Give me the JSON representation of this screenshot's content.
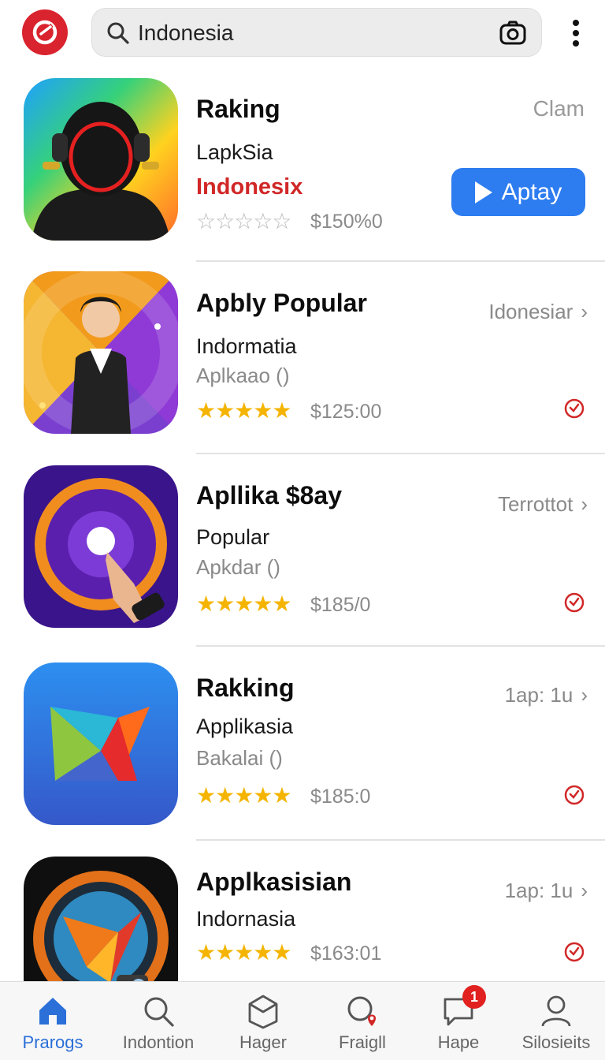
{
  "header": {
    "search_value": "Indonesia",
    "search_icon": "search-icon",
    "camera_icon": "camera-icon",
    "menu_icon": "more-vert-icon"
  },
  "colors": {
    "brand_red": "#d9232e",
    "accent_blue": "#2d7cf0",
    "star_gold": "#f4b400",
    "nav_active": "#2b6fd8"
  },
  "apps": [
    {
      "title": "Raking",
      "subtitle": "LapkSia",
      "highlight": "Indonesix",
      "rating": 0,
      "price": "$150%0",
      "right_label": "Clam",
      "action_label": "Aptay"
    },
    {
      "title": "Apbly Popular",
      "subtitle": "Indormatia",
      "subtitle2": "Aplkaao ()",
      "rating": 5,
      "price": "$125:00",
      "right_label": "Idonesiar"
    },
    {
      "title": "Apllika $8ay",
      "subtitle": "Popular",
      "subtitle2": "Apkdar ()",
      "rating": 5,
      "price": "$185/0",
      "right_label": "Terrottot"
    },
    {
      "title": "Rakking",
      "subtitle": "Applikasia",
      "subtitle2": "Bakalai ()",
      "rating": 5,
      "price": "$185:0",
      "right_label": "1ap: 1u"
    },
    {
      "title": "Applkasisian",
      "subtitle": "Indornasia",
      "rating": 5,
      "price": "$163:01",
      "right_label": "1ap: 1u"
    }
  ],
  "nav": [
    {
      "label": "Prarogs",
      "icon": "home-icon",
      "active": true
    },
    {
      "label": "Indontion",
      "icon": "search-icon",
      "active": false
    },
    {
      "label": "Hager",
      "icon": "package-icon",
      "active": false
    },
    {
      "label": "Fraigll",
      "icon": "map-search-icon",
      "active": false
    },
    {
      "label": "Hape",
      "icon": "chat-icon",
      "active": false,
      "badge": "1"
    },
    {
      "label": "Silosieits",
      "icon": "profile-icon",
      "active": false
    }
  ]
}
